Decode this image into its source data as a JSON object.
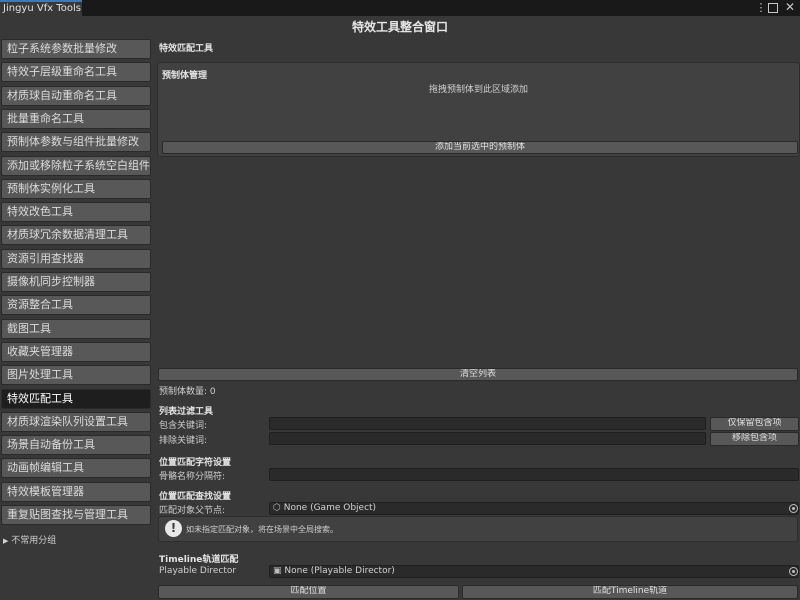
{
  "window": {
    "tab_title": "Jingyu Vfx Tools",
    "title": "特效工具整合窗口",
    "menu_icon": "kebab-menu-icon",
    "close_glyph": "✕"
  },
  "sidebar": {
    "items": [
      {
        "label": "粒子系统参数批量修改"
      },
      {
        "label": "特效子层级重命名工具"
      },
      {
        "label": "材质球自动重命名工具"
      },
      {
        "label": "批量重命名工具"
      },
      {
        "label": "预制体参数与组件批量修改"
      },
      {
        "label": "添加或移除粒子系统空白组件"
      },
      {
        "label": "预制体实例化工具"
      },
      {
        "label": "特效改色工具"
      },
      {
        "label": "材质球冗余数据清理工具"
      },
      {
        "label": "资源引用查找器"
      },
      {
        "label": "摄像机同步控制器"
      },
      {
        "label": "资源整合工具"
      },
      {
        "label": "截图工具"
      },
      {
        "label": "收藏夹管理器"
      },
      {
        "label": "图片处理工具"
      },
      {
        "label": "特效匹配工具",
        "active": true
      },
      {
        "label": "材质球渲染队列设置工具"
      },
      {
        "label": "场景自动备份工具"
      },
      {
        "label": "动画帧编辑工具"
      },
      {
        "label": "特效模板管理器"
      },
      {
        "label": "重复贴图查找与管理工具"
      }
    ],
    "group": {
      "arrow": "▶",
      "label": "不常用分组"
    }
  },
  "main": {
    "section_title": "特效匹配工具",
    "prefab_box": {
      "title": "预制体管理",
      "drop_hint": "拖拽预制体到此区域添加",
      "add_button": "添加当前选中的预制体"
    },
    "clear_button": "清空列表",
    "prefab_count": "预制体数量: 0",
    "filter": {
      "title": "列表过滤工具",
      "include_label": "包含关键词:",
      "include_value": "",
      "include_button": "仅保留包含项",
      "exclude_label": "排除关键词:",
      "exclude_value": "",
      "exclude_button": "移除包含项"
    },
    "position_char": {
      "title": "位置匹配字符设置",
      "separator_label": "骨骼名称分隔符:",
      "separator_value": ""
    },
    "position_search": {
      "title": "位置匹配查找设置",
      "parent_label": "匹配对象父节点:",
      "parent_value": "None (Game Object)",
      "help": "如未指定匹配对象，将在场景中全局搜索。"
    },
    "timeline": {
      "title": "Timeline轨道匹配",
      "director_label": "Playable Director",
      "director_value": "None (Playable Director)"
    },
    "buttons": {
      "match_position": "匹配位置",
      "match_timeline": "匹配Timeline轨道"
    }
  }
}
